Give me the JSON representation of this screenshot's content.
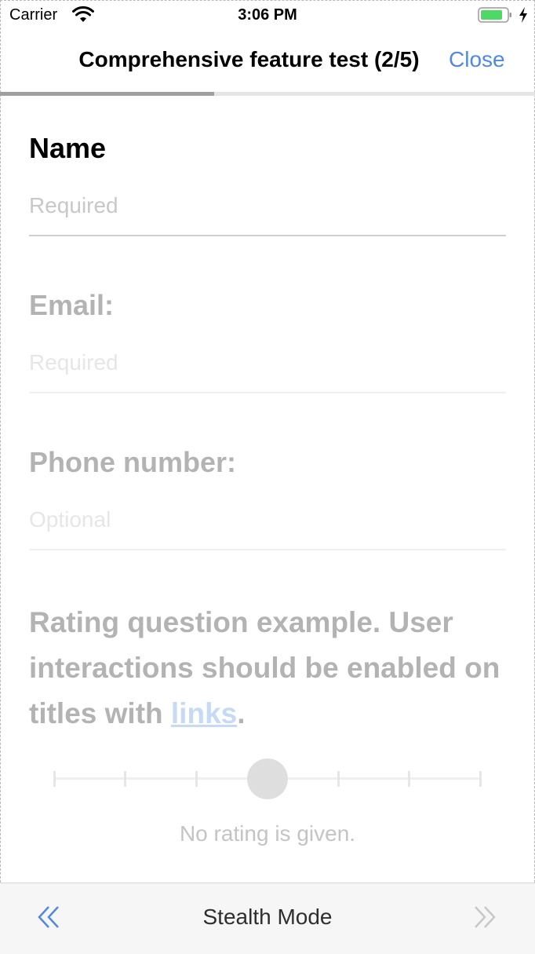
{
  "status_bar": {
    "carrier": "Carrier",
    "time": "3:06 PM",
    "battery_color": "#4cd964"
  },
  "nav": {
    "title": "Comprehensive feature test (2/5)",
    "close_label": "Close",
    "progress": 0.4,
    "accent": "#4f8ae0"
  },
  "form": {
    "name": {
      "label": "Name",
      "placeholder": "Required"
    },
    "email": {
      "label": "Email:",
      "placeholder": "Required"
    },
    "phone": {
      "label": "Phone number:",
      "placeholder": "Optional"
    }
  },
  "rating": {
    "question_text": "Rating question example. User interactions should be enabled on titles with ",
    "link_text": "links",
    "question_end": ".",
    "status_text": "No rating is given."
  },
  "toolbar": {
    "title": "Stealth Mode",
    "prev_icon": "double-chevron-left-icon",
    "next_icon": "double-chevron-right-icon"
  }
}
